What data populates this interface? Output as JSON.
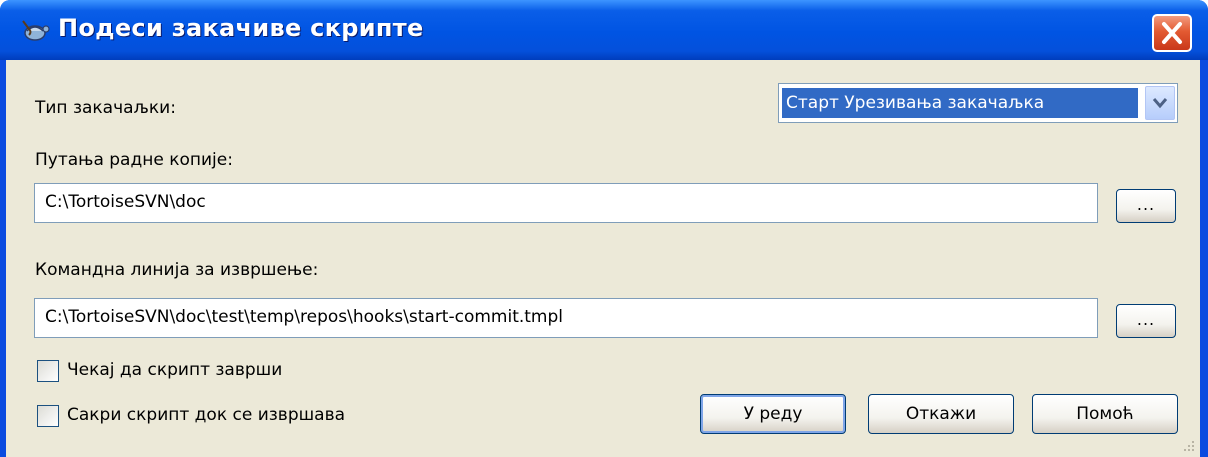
{
  "window": {
    "title": "Подеси закачиве скрипте"
  },
  "form": {
    "hook_type_label": "Тип закачаљки:",
    "hook_type_selected": "Старт Урезивања закачаљка",
    "working_copy_label": "Путања радне копије:",
    "working_copy_value": "C:\\TortoiseSVN\\doc",
    "command_line_label": "Командна линија за извршење:",
    "command_line_value": "C:\\TortoiseSVN\\doc\\test\\temp\\repos\\hooks\\start-commit.tmpl",
    "browse_label": "...",
    "wait_label": "Чекај да скрипт заврши",
    "hide_label": "Сакри скрипт док се извршава",
    "wait_checked": false,
    "hide_checked": false
  },
  "buttons": {
    "ok": "У реду",
    "cancel": "Откажи",
    "help": "Помоћ"
  },
  "icons": {
    "app": "tortoise-hook-icon",
    "close": "close-icon",
    "dropdown": "chevron-down-icon",
    "resize": "resize-grip-icon"
  }
}
